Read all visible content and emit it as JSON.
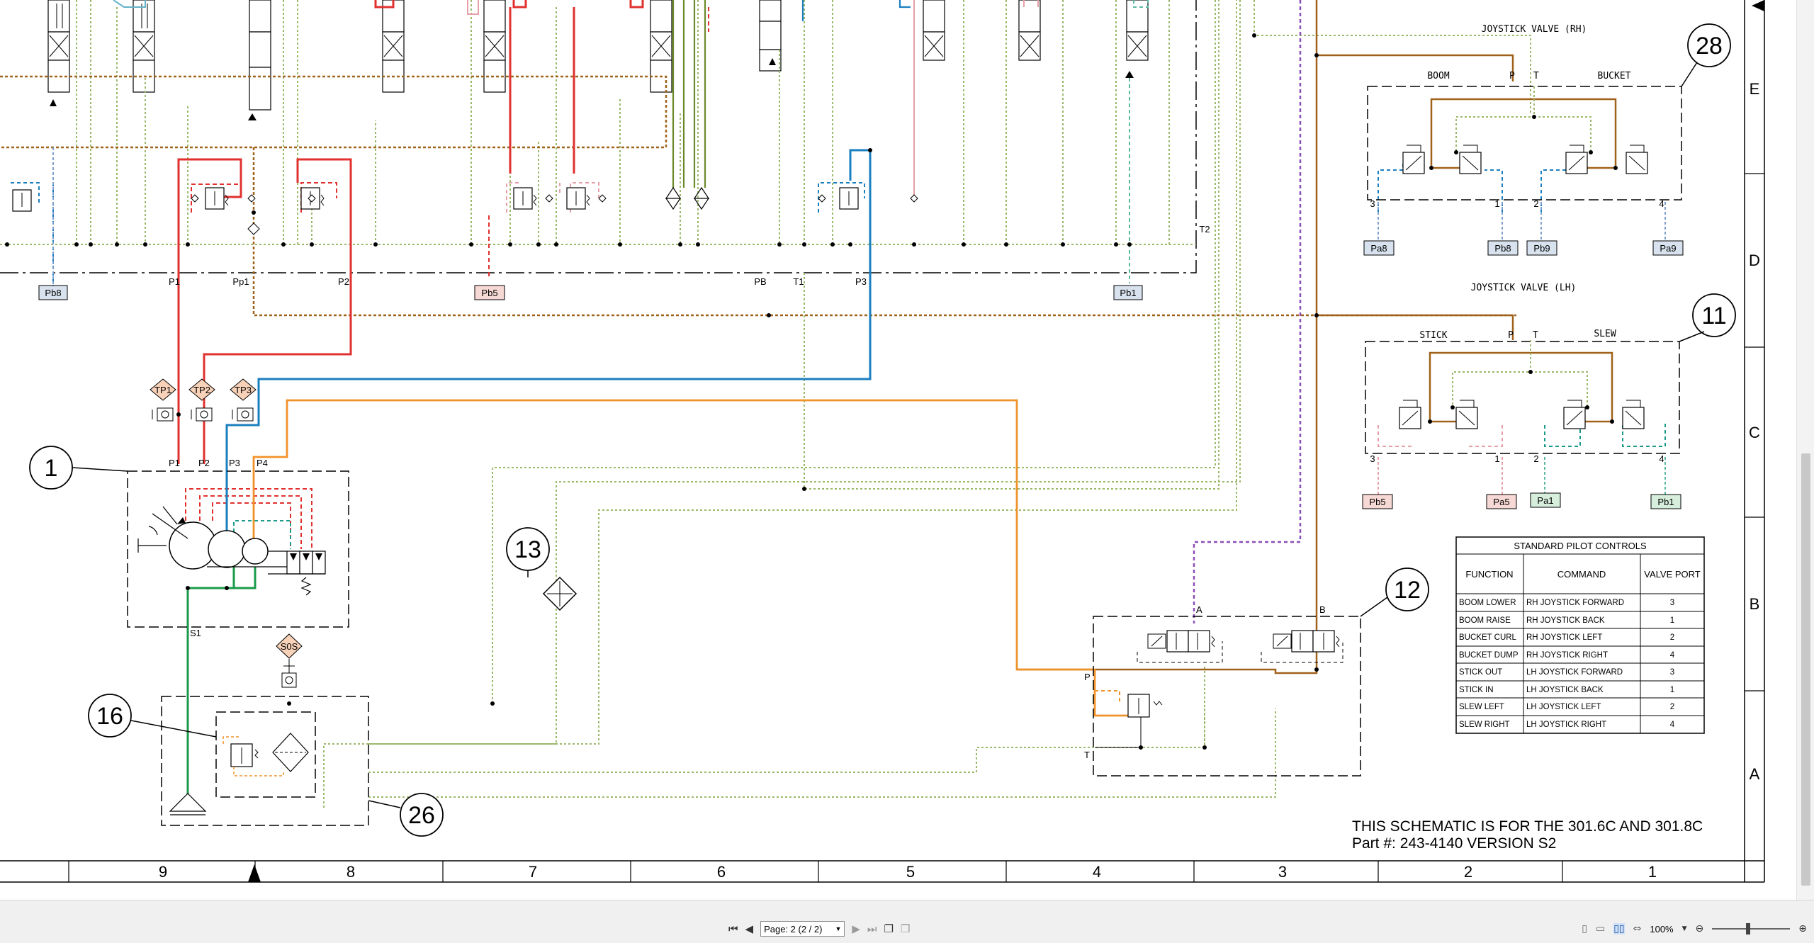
{
  "schematic": {
    "title_line1": "THIS SCHEMATIC IS FOR THE 301.6C AND 301.8C",
    "title_line2": "Part #: 243-4140 VERSION S2",
    "zone_columns": [
      "9",
      "8",
      "7",
      "6",
      "5",
      "4",
      "3",
      "2",
      "1"
    ],
    "zone_rows": [
      "E",
      "D",
      "C",
      "B",
      "A"
    ],
    "callouts": [
      "28",
      "11",
      "1",
      "13",
      "12",
      "16",
      "26"
    ],
    "joystick_rh": {
      "title": "JOYSTICK VALVE (RH)",
      "left": "BOOM",
      "right": "BUCKET",
      "p": "P",
      "t": "T",
      "ports": [
        "3",
        "1",
        "2",
        "4"
      ],
      "tags": [
        "Pa8",
        "Pb8",
        "Pb9",
        "Pa9"
      ]
    },
    "joystick_lh": {
      "title": "JOYSTICK VALVE (LH)",
      "left": "STICK",
      "right": "SLEW",
      "p": "P",
      "t": "T",
      "ports": [
        "3",
        "1",
        "2",
        "4"
      ],
      "tags": [
        "Pb5",
        "Pa5",
        "Pa1",
        "Pb1"
      ]
    },
    "valve_tags": [
      "Pb8",
      "Pb5",
      "Pb1"
    ],
    "port_labels": {
      "p1": "P1",
      "pp1": "Pp1",
      "p2": "P2",
      "pb": "PB",
      "t1": "T1",
      "p3": "P3",
      "t2": "T2"
    },
    "test_points": [
      "TP1",
      "TP2",
      "TP3",
      "S0S"
    ],
    "pump_ports": [
      "P1",
      "P2",
      "P3",
      "P4",
      "S1"
    ],
    "valve12_ports": {
      "a": "A",
      "b": "B",
      "p": "P",
      "t": "T"
    },
    "pilot_table": {
      "title": "STANDARD  PILOT CONTROLS",
      "headers": [
        "FUNCTION",
        "COMMAND",
        "VALVE PORT"
      ],
      "rows": [
        [
          "BOOM LOWER",
          "RH JOYSTICK FORWARD",
          "3"
        ],
        [
          "BOOM RAISE",
          "RH JOYSTICK BACK",
          "1"
        ],
        [
          "BUCKET CURL",
          "RH JOYSTICK LEFT",
          "2"
        ],
        [
          "BUCKET DUMP",
          "RH JOYSTICK RIGHT",
          "4"
        ],
        [
          "STICK OUT",
          "LH JOYSTICK FORWARD",
          "3"
        ],
        [
          "STICK IN",
          "LH JOYSTICK BACK",
          "1"
        ],
        [
          "SLEW LEFT",
          "LH JOYSTICK LEFT",
          "2"
        ],
        [
          "SLEW RIGHT",
          "LH JOYSTICK RIGHT",
          "4"
        ]
      ]
    }
  },
  "colors": {
    "red": "#e0312f",
    "blue": "#1a7fbf",
    "orange": "#f0922a",
    "brown": "#a0621a",
    "green": "#1a9a4a",
    "olive": "#9cb86a",
    "purple": "#8a4fb5",
    "pink": "#e6a0a8",
    "tag_blue": "#d8e2ee",
    "tag_pink": "#f6d8d4",
    "tag_green": "#d6eedb",
    "tp_fill": "#f8d2b8"
  },
  "viewer": {
    "page_label": "Page: 2 (2 / 2)",
    "zoom": "100%",
    "icons": [
      "first-page-icon",
      "prev-page-icon",
      "next-page-icon",
      "last-page-icon",
      "single-page-view-icon",
      "continuous-view-icon",
      "two-page-view-icon",
      "fit-width-icon",
      "zoom-out-icon",
      "zoom-in-icon"
    ]
  }
}
